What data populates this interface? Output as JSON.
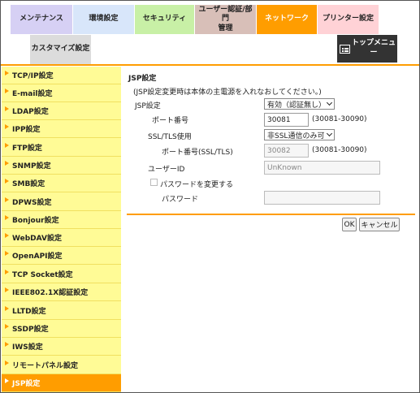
{
  "tabs": {
    "maintenance": "メンテナンス",
    "environment": "環境設定",
    "security": "セキュリティ",
    "auth_line1": "ユーザー認証/部門",
    "auth_line2": "管理",
    "network": "ネットワーク",
    "printer": "プリンター設定",
    "customize": "カスタマイズ設定",
    "top_menu_line1": "トップメニュ",
    "top_menu_line2": "ー"
  },
  "sidebar": {
    "items": [
      {
        "label": "TCP/IP設定"
      },
      {
        "label": "E-mail設定"
      },
      {
        "label": "LDAP設定"
      },
      {
        "label": "IPP設定"
      },
      {
        "label": "FTP設定"
      },
      {
        "label": "SNMP設定"
      },
      {
        "label": "SMB設定"
      },
      {
        "label": "DPWS設定"
      },
      {
        "label": "Bonjour設定"
      },
      {
        "label": "WebDAV設定"
      },
      {
        "label": "OpenAPI設定"
      },
      {
        "label": "TCP Socket設定"
      },
      {
        "label": "IEEE802.1X認証設定"
      },
      {
        "label": "LLTD設定"
      },
      {
        "label": "SSDP設定"
      },
      {
        "label": "IWS設定"
      },
      {
        "label": "リモートパネル設定"
      },
      {
        "label": "JSP設定",
        "active": true
      }
    ]
  },
  "main": {
    "title": "JSP設定",
    "notice": "(JSP設定変更時は本体の主電源を入れなおしてください。)",
    "jsp_setting_label": "JSP設定",
    "jsp_setting_value": "有効（認証無し）",
    "port_label": "ポート番号",
    "port_value": "30081",
    "port_range": "(30081-30090)",
    "ssl_label": "SSL/TLS使用",
    "ssl_value": "非SSL通信のみ可",
    "ssl_port_label": "ポート番号(SSL/TLS)",
    "ssl_port_value": "30082",
    "ssl_port_range": "(30081-30090)",
    "user_id_label": "ユーザーID",
    "user_id_value": "UnKnown",
    "change_password_label": "パスワードを変更する",
    "password_label": "パスワード",
    "password_value": "",
    "ok_label": "OK",
    "cancel_label": "キャンセル"
  },
  "colors": {
    "accent": "#ff9d00",
    "sidebar_bg": "#fffb96"
  }
}
